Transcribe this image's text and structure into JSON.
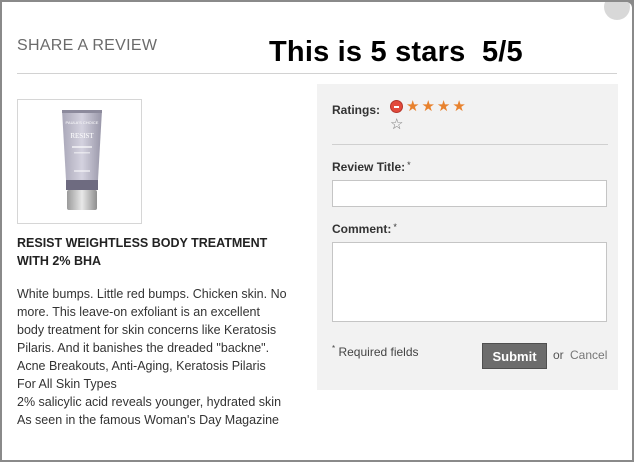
{
  "modal": {
    "title": "SHARE A REVIEW",
    "overlay_text": "This is 5 stars  5/5"
  },
  "product": {
    "name": "RESIST WEIGHTLESS BODY TREATMENT WITH 2% BHA",
    "image_brand": "PAULA'S CHOICE",
    "image_label": "RESIST",
    "description_lines": [
      "White bumps. Little red bumps. Chicken skin. No",
      "more. This leave-on exfoliant is an excellent",
      "body treatment for skin concerns like Keratosis",
      "Pilaris. And it banishes the dreaded \"backne\".",
      "Acne Breakouts, Anti-Aging, Keratosis Pilaris",
      "For All Skin Types",
      "2% salicylic acid reveals younger, hydrated skin",
      "As seen in the famous Woman's Day Magazine"
    ]
  },
  "form": {
    "ratings_label": "Ratings:",
    "rating": {
      "value": 4,
      "max": 5
    },
    "review_title_label": "Review Title:",
    "review_title_value": "",
    "comment_label": "Comment:",
    "comment_value": "",
    "required_marker": "*",
    "required_note": "Required fields",
    "submit_label": "Submit",
    "or_text": "or",
    "cancel_label": "Cancel"
  },
  "colors": {
    "star_filled": "#e8822e",
    "remove_rating": "#e24a3c",
    "submit_bg": "#6c6c6c",
    "panel_bg": "#f2f2f2"
  },
  "icons": [
    "remove-rating-icon",
    "star-filled-icon",
    "star-empty-icon",
    "close-icon"
  ]
}
